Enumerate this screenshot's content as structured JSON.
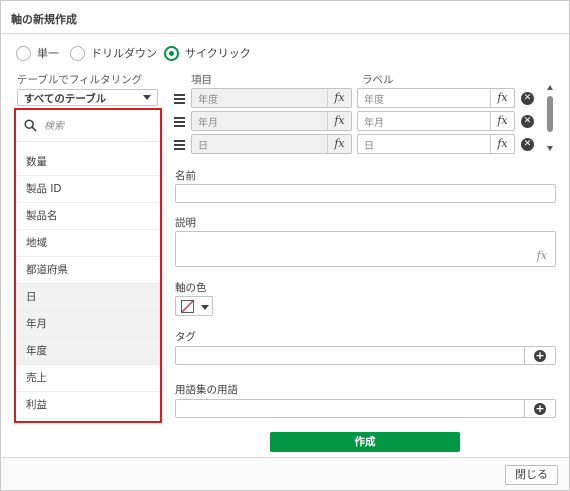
{
  "dialog": {
    "title": "軸の新規作成",
    "close_label": "閉じる",
    "create_label": "作成"
  },
  "mode": {
    "options": [
      {
        "label": "単一",
        "selected": false
      },
      {
        "label": "ドリルダウン",
        "selected": false
      },
      {
        "label": "サイクリック",
        "selected": true
      }
    ],
    "accent_color": "#009845"
  },
  "filter": {
    "label": "テーブルでフィルタリング",
    "value": "すべてのテーブル"
  },
  "search": {
    "placeholder": "検索"
  },
  "fields": [
    {
      "label": "数量",
      "in_use": false
    },
    {
      "label": "製品 ID",
      "in_use": false
    },
    {
      "label": "製品名",
      "in_use": false
    },
    {
      "label": "地域",
      "in_use": false
    },
    {
      "label": "都道府県",
      "in_use": false
    },
    {
      "label": "日",
      "in_use": true
    },
    {
      "label": "年月",
      "in_use": true
    },
    {
      "label": "年度",
      "in_use": true
    },
    {
      "label": "売上",
      "in_use": false
    },
    {
      "label": "利益",
      "in_use": false
    }
  ],
  "columns": {
    "item": "項目",
    "label": "ラベル"
  },
  "rows": [
    {
      "item": "年度",
      "label": "年度"
    },
    {
      "item": "年月",
      "label": "年月"
    },
    {
      "item": "日",
      "label": "日"
    }
  ],
  "form": {
    "name_label": "名前",
    "description_label": "説明",
    "color_label": "軸の色",
    "tags_label": "タグ",
    "glossary_label": "用語集の用語"
  },
  "icons": {
    "fx": "fx",
    "remove": "✕",
    "add": "+"
  },
  "highlight_color": "#e01b1b"
}
